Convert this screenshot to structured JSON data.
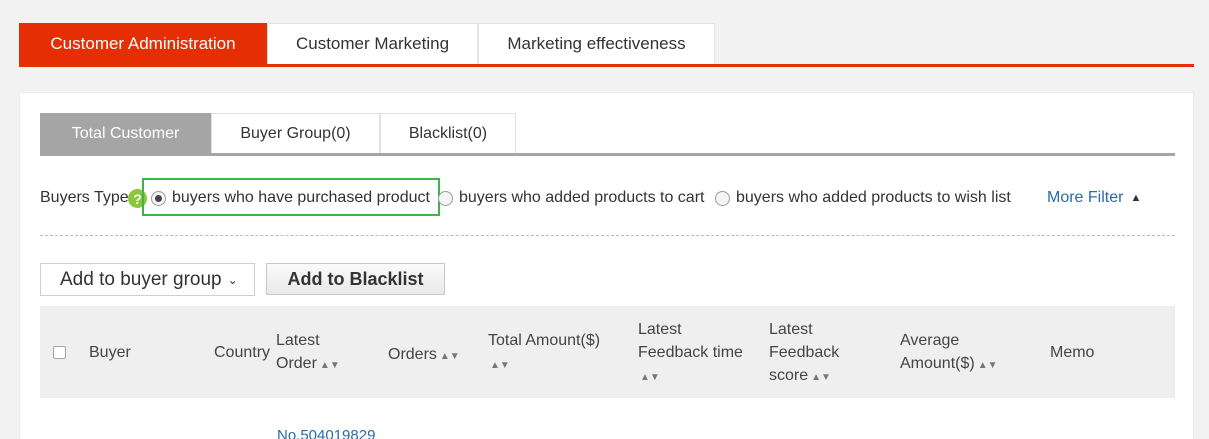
{
  "top_tabs": [
    {
      "label": "Customer Administration"
    },
    {
      "label": "Customer Marketing"
    },
    {
      "label": "Marketing effectiveness"
    }
  ],
  "sub_tabs": [
    {
      "label": "Total Customer"
    },
    {
      "label": "Buyer Group(0)"
    },
    {
      "label": "Blacklist(0)"
    }
  ],
  "filter": {
    "label": "Buyers Type",
    "help_glyph": "?",
    "options": [
      {
        "label": "buyers who have purchased product",
        "checked": true
      },
      {
        "label": "buyers who added products to cart",
        "checked": false
      },
      {
        "label": "buyers who added products to wish list",
        "checked": false
      }
    ],
    "more_filter": "More Filter"
  },
  "actions": {
    "add_to_group": "Add to buyer group",
    "add_to_blacklist": "Add to Blacklist"
  },
  "table": {
    "headers": {
      "buyer": "Buyer",
      "country": "Country",
      "latest_order_1": "Latest",
      "latest_order_2": "Order",
      "orders": "Orders",
      "total_amount": "Total Amount($)",
      "latest_feedback_time_1": "Latest",
      "latest_feedback_time_2": "Feedback time",
      "latest_feedback_score_1": "Latest",
      "latest_feedback_score_2": "Feedback",
      "latest_feedback_score_3": "score",
      "average_amount_1": "Average",
      "average_amount_2": "Amount($)",
      "memo": "Memo"
    },
    "first_row_order": "No.504019829"
  },
  "colors": {
    "accent": "#e62e04",
    "highlight": "#3db54a",
    "help": "#8cc63e",
    "link": "#2a6aa8"
  }
}
